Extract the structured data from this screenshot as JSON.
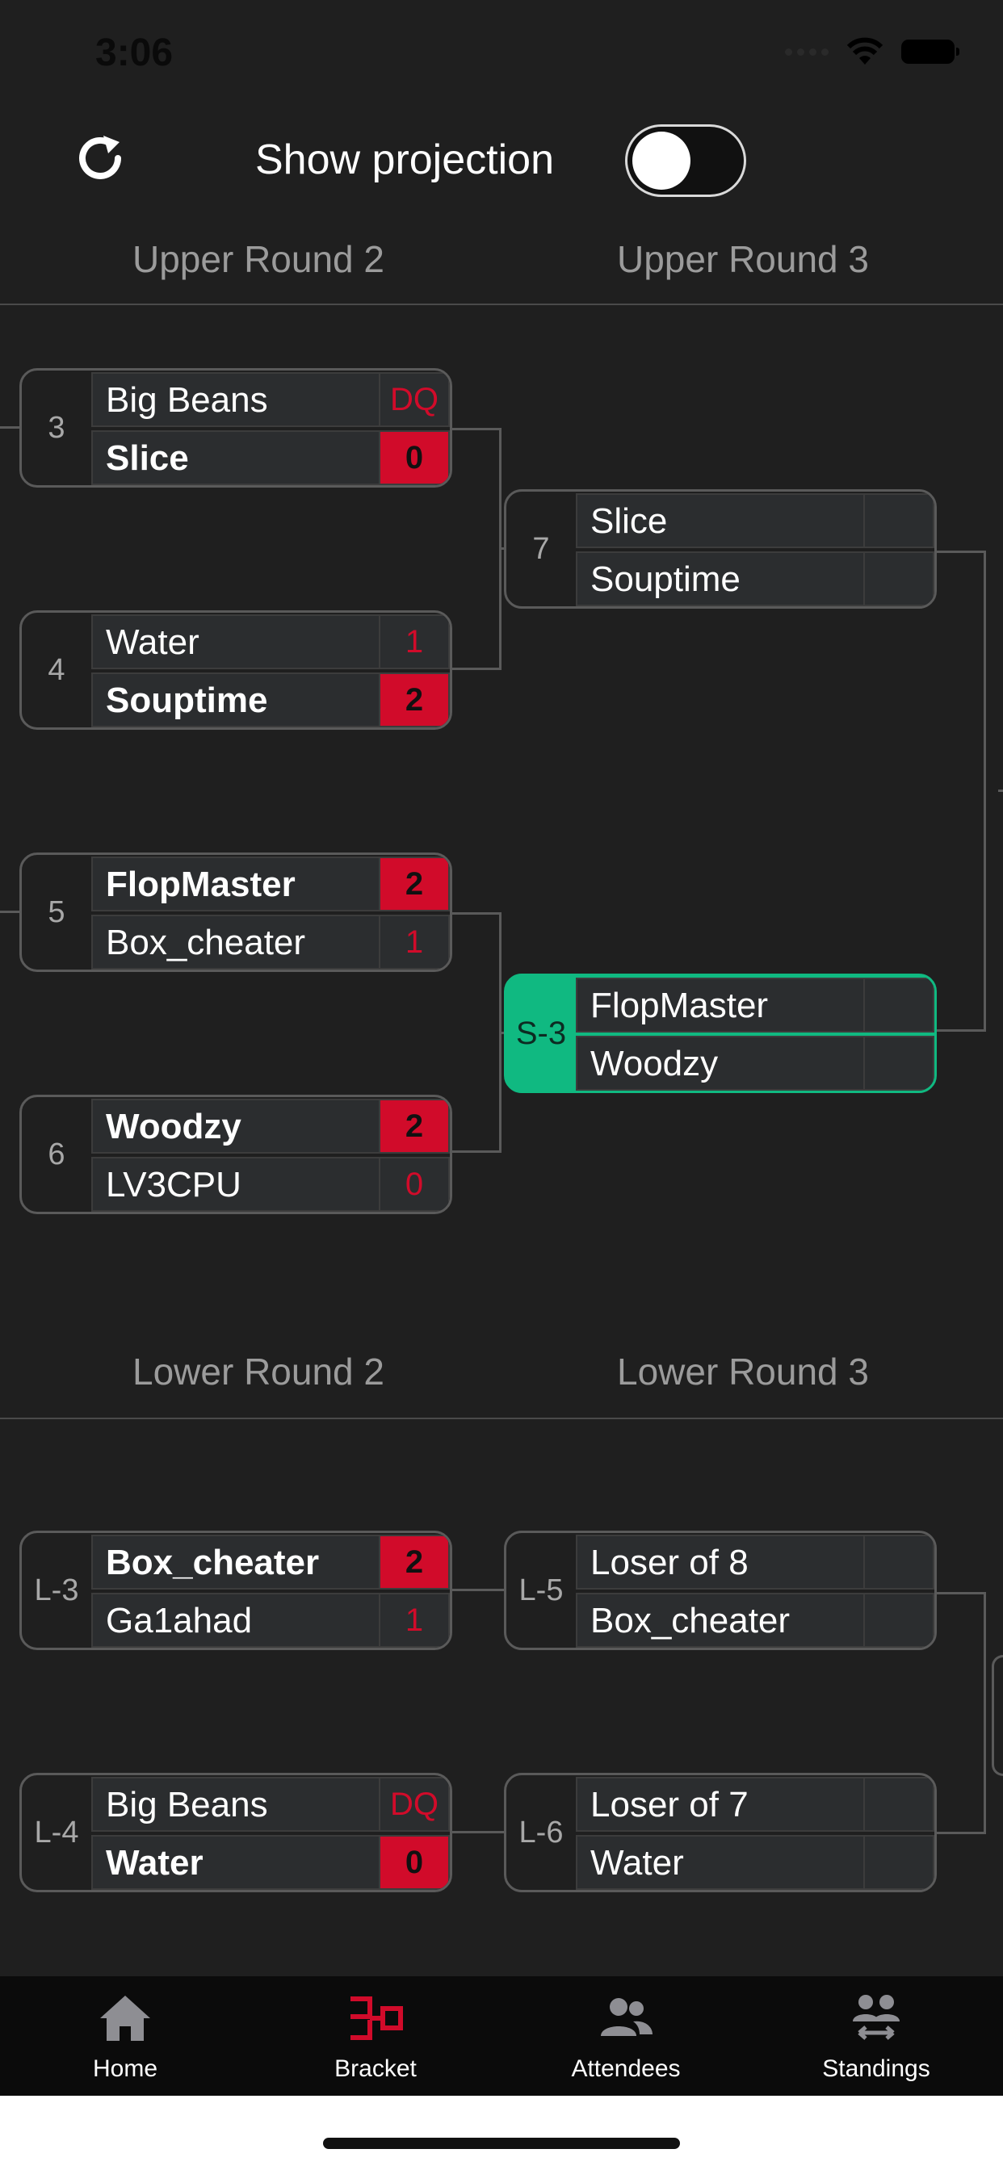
{
  "status": {
    "time": "3:06"
  },
  "toolbar": {
    "projection_label": "Show projection",
    "projection_enabled": false
  },
  "upper": {
    "round_titles": [
      "Upper Round 2",
      "Upper Round 3"
    ],
    "matches": [
      {
        "id": "3",
        "p1": "Big Beans",
        "s1": "DQ",
        "p2": "Slice",
        "s2": "0",
        "winner": 2
      },
      {
        "id": "4",
        "p1": "Water",
        "s1": "1",
        "p2": "Souptime",
        "s2": "2",
        "winner": 2
      },
      {
        "id": "5",
        "p1": "FlopMaster",
        "s1": "2",
        "p2": "Box_cheater",
        "s2": "1",
        "winner": 1
      },
      {
        "id": "6",
        "p1": "Woodzy",
        "s1": "2",
        "p2": "LV3CPU",
        "s2": "0",
        "winner": 1
      },
      {
        "id": "7",
        "p1": "Slice",
        "s1": "",
        "p2": "Souptime",
        "s2": ""
      },
      {
        "id": "S-3",
        "p1": "FlopMaster",
        "s1": "",
        "p2": "Woodzy",
        "s2": "",
        "highlight_color": "#10b981"
      }
    ]
  },
  "lower": {
    "round_titles": [
      "Lower Round 2",
      "Lower Round 3"
    ],
    "matches": [
      {
        "id": "L-3",
        "p1": "Box_cheater",
        "s1": "2",
        "p2": "Ga1ahad",
        "s2": "1",
        "winner": 1
      },
      {
        "id": "L-4",
        "p1": "Big Beans",
        "s1": "DQ",
        "p2": "Water",
        "s2": "0",
        "winner": 2
      },
      {
        "id": "L-5",
        "p1": "Loser of 8",
        "s1": "",
        "p2": "Box_cheater",
        "s2": ""
      },
      {
        "id": "L-6",
        "p1": "Loser of 7",
        "s1": "",
        "p2": "Water",
        "s2": ""
      }
    ]
  },
  "tabs": [
    {
      "label": "Home",
      "icon": "home-icon",
      "active": false
    },
    {
      "label": "Bracket",
      "icon": "bracket-icon",
      "active": true
    },
    {
      "label": "Attendees",
      "icon": "attendees-icon",
      "active": false
    },
    {
      "label": "Standings",
      "icon": "standings-icon",
      "active": false
    }
  ],
  "colors": {
    "accent": "#d10b2a",
    "highlight": "#10b981",
    "background": "#1f1f1f"
  }
}
